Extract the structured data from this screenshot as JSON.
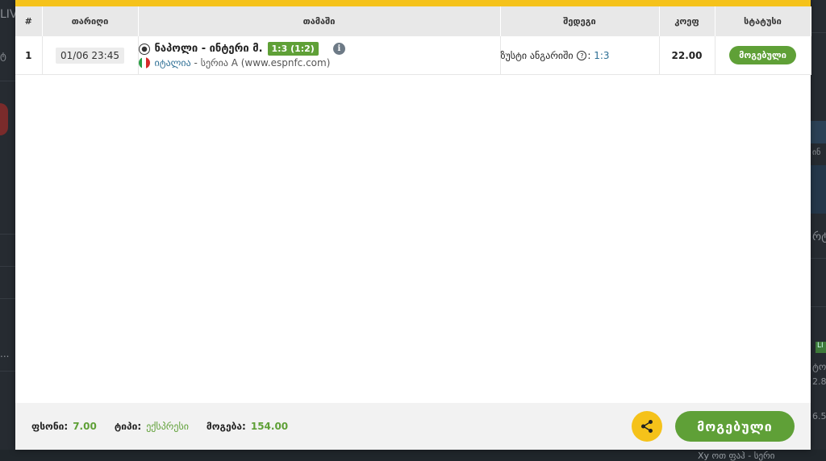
{
  "background": {
    "left_texts": [
      "LIV",
      "ტ",
      "..."
    ],
    "right_texts": [
      "ინ",
      "რტ",
      "LI",
      "ტო",
      "2.8",
      "6.5"
    ],
    "bottom_text": "Xy ოთ ფაჰ - სერი"
  },
  "table": {
    "headers": [
      "#",
      "თარიღი",
      "თამაში",
      "შედეგი",
      "კოეფ",
      "სტატუსი"
    ],
    "rows": [
      {
        "num": "1",
        "date": "01/06 23:45",
        "match": "ნაპოლი - ინტერი მ.",
        "score": "1:3 (1:2)",
        "country": "იტალია",
        "league": " - სერია A (www.espnfc.com)",
        "event_label": "ზუსტი ანგარიში",
        "event_value": "1:3",
        "odds": "22.00",
        "status": "მოგებული"
      }
    ]
  },
  "footer": {
    "bonus_label": "ფსონი:",
    "bonus_value": "7.00",
    "type_label": "ტიპი:",
    "type_value": "ექსპრესი",
    "win_label": "მოგება:",
    "win_value": "154.00",
    "won_button": "მოგებული"
  },
  "colors": {
    "accent_yellow": "#f5c21a",
    "success_green": "#5fa037",
    "link_blue": "#2e6f95"
  }
}
